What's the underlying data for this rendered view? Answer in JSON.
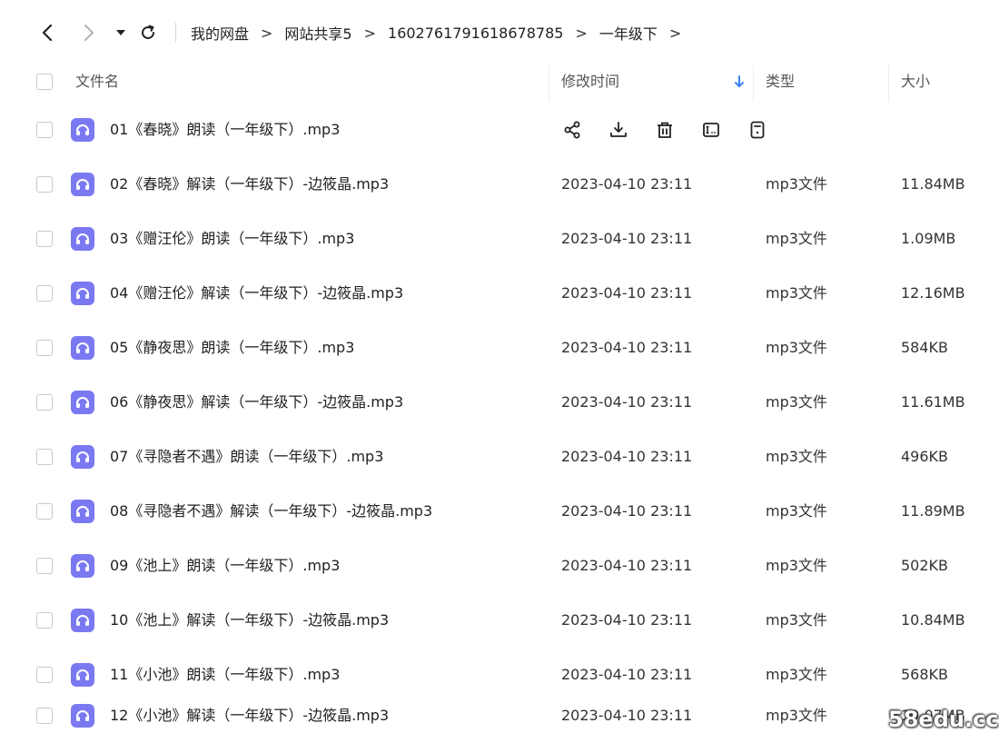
{
  "breadcrumb": [
    "我的网盘",
    "网站共享5",
    "1602761791618678785",
    "一年级下"
  ],
  "breadcrumb_separator": ">",
  "columns": {
    "name": "文件名",
    "modified": "修改时间",
    "type": "类型",
    "size": "大小"
  },
  "colors": {
    "icon_bg": "#7b79f2",
    "sort_arrow": "#3b82f6"
  },
  "files": [
    {
      "name": "01《春晓》朗读（一年级下）.mp3",
      "date": "",
      "type": "",
      "size": "",
      "hovered": true
    },
    {
      "name": "02《春晓》解读（一年级下）-边筱晶.mp3",
      "date": "2023-04-10 23:11",
      "type": "mp3文件",
      "size": "11.84MB"
    },
    {
      "name": "03《赠汪伦》朗读（一年级下）.mp3",
      "date": "2023-04-10 23:11",
      "type": "mp3文件",
      "size": "1.09MB"
    },
    {
      "name": "04《赠汪伦》解读（一年级下）-边筱晶.mp3",
      "date": "2023-04-10 23:11",
      "type": "mp3文件",
      "size": "12.16MB"
    },
    {
      "name": "05《静夜思》朗读（一年级下）.mp3",
      "date": "2023-04-10 23:11",
      "type": "mp3文件",
      "size": "584KB"
    },
    {
      "name": "06《静夜思》解读（一年级下）-边筱晶.mp3",
      "date": "2023-04-10 23:11",
      "type": "mp3文件",
      "size": "11.61MB"
    },
    {
      "name": "07《寻隐者不遇》朗读（一年级下）.mp3",
      "date": "2023-04-10 23:11",
      "type": "mp3文件",
      "size": "496KB"
    },
    {
      "name": "08《寻隐者不遇》解读（一年级下）-边筱晶.mp3",
      "date": "2023-04-10 23:11",
      "type": "mp3文件",
      "size": "11.89MB"
    },
    {
      "name": "09《池上》朗读（一年级下）.mp3",
      "date": "2023-04-10 23:11",
      "type": "mp3文件",
      "size": "502KB"
    },
    {
      "name": "10《池上》解读（一年级下）-边筱晶.mp3",
      "date": "2023-04-10 23:11",
      "type": "mp3文件",
      "size": "10.84MB"
    },
    {
      "name": "11《小池》朗读（一年级下）.mp3",
      "date": "2023-04-10 23:11",
      "type": "mp3文件",
      "size": "568KB"
    },
    {
      "name": "12《小池》解读（一年级下）-边筱晶.mp3",
      "date": "2023-04-10 23:11",
      "type": "mp3文件",
      "size": "10.07MB"
    }
  ],
  "hover_actions": [
    "share-icon",
    "download-icon",
    "delete-icon",
    "rename-icon",
    "more-icon"
  ],
  "watermark": "58edu.cc"
}
